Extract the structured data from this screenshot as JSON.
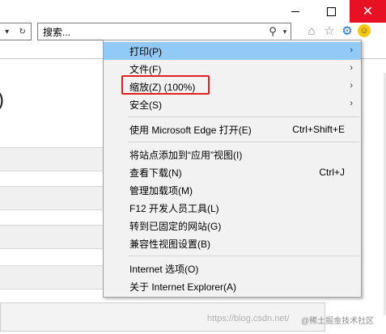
{
  "window": {
    "minimize_icon": "minimize-icon",
    "maximize_icon": "maximize-icon",
    "close_glyph": "✕",
    "close_color": "#e81123"
  },
  "address_bar": {
    "back_glyph": "▾",
    "refresh_glyph": "↻",
    "search_value": "搜索...",
    "search_icon": "⚲",
    "dropdown_glyph": "▾"
  },
  "toolbar": {
    "home_glyph": "⌂",
    "favorites_glyph": "☆",
    "tools_glyph": "⚙",
    "feedback_glyph": "☺"
  },
  "page": {
    "partial_paren": ")"
  },
  "menu": {
    "highlight_color": "#91c9f7",
    "groups": [
      [
        {
          "label": "打印(P)",
          "arrow": "›",
          "highlighted": true
        },
        {
          "label": "文件(F)",
          "arrow": "›"
        },
        {
          "label": "缩放(Z) (100%)",
          "arrow": "›"
        },
        {
          "label": "安全(S)",
          "arrow": "›"
        }
      ],
      [
        {
          "label": "使用 Microsoft Edge 打开(E)",
          "shortcut": "Ctrl+Shift+E"
        }
      ],
      [
        {
          "label": "将站点添加到“应用”视图(I)"
        },
        {
          "label": "查看下载(N)",
          "shortcut": "Ctrl+J"
        },
        {
          "label": "管理加载项(M)"
        },
        {
          "label": "F12 开发人员工具(L)"
        },
        {
          "label": "转到已固定的网站(G)"
        },
        {
          "label": "兼容性视图设置(B)"
        }
      ],
      [
        {
          "label": "Internet 选项(O)"
        },
        {
          "label": "关于 Internet Explorer(A)"
        }
      ]
    ]
  },
  "watermark": {
    "text": "https://blog.csdn.net/",
    "badge": "@稀土掘金技术社区"
  }
}
